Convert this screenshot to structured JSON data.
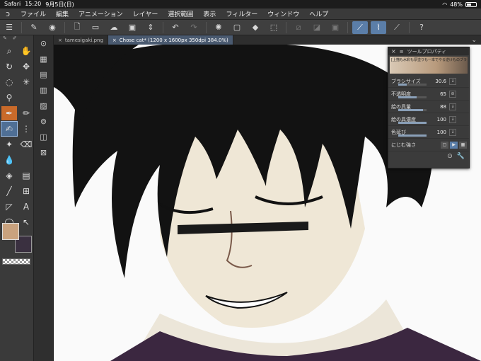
{
  "status": {
    "app": "Safari",
    "time": "15:20",
    "date": "9月5日(日)",
    "battery": "48%"
  },
  "menu": [
    "ファイル",
    "編集",
    "アニメーション",
    "レイヤー",
    "選択範囲",
    "表示",
    "フィルター",
    "ウィンドウ",
    "ヘルプ"
  ],
  "tabs": [
    {
      "label": "tamesigaki.png"
    },
    {
      "label": "Chose cat* (1200 x 1600px 350dpi 384.0%)"
    }
  ],
  "tool_property": {
    "title": "ツールプロパティ",
    "preset": "[上描も水彩も厚塗りも一本でやる逆けものブラ",
    "rows": [
      {
        "label": "ブラシサイズ",
        "value": "30.6",
        "fraction": 0.3
      },
      {
        "label": "不透明度",
        "value": "65",
        "fraction": 0.65
      },
      {
        "label": "絵の具量",
        "value": "88",
        "fraction": 0.88
      },
      {
        "label": "絵の具濃度",
        "value": "100",
        "fraction": 1.0
      },
      {
        "label": "色延び",
        "value": "100",
        "fraction": 1.0
      },
      {
        "label": "にじむ強さ",
        "value": "",
        "fraction": 0
      }
    ]
  },
  "colors": {
    "main": "#c9a27e",
    "sub": "#3a3040",
    "accent": "#5b7ea8"
  }
}
